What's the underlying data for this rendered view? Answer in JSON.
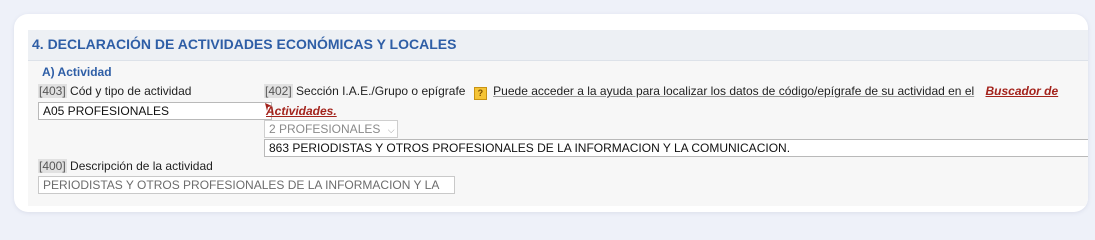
{
  "section": {
    "title": "4. DECLARACIÓN DE ACTIVIDADES ECONÓMICAS Y LOCALES"
  },
  "subsection": {
    "title": "A) Actividad"
  },
  "field_403": {
    "code": "[403]",
    "label": "Cód y tipo de actividad",
    "value": "A05 PROFESIONALES"
  },
  "field_402": {
    "code": "[402]",
    "label": "Sección I.A.E./Grupo o epígrafe",
    "help_icon": "help-icon",
    "help_text": "Puede acceder a la ayuda para localizar los datos de código/epígrafe de su actividad en el",
    "help_link_part1": "Buscador de",
    "help_link_part2": "Actividades.",
    "select_value": "2 PROFESIONALES",
    "epigrafe_value": "863 PERIODISTAS Y OTROS PROFESIONALES DE LA INFORMACION Y LA COMUNICACION."
  },
  "field_400": {
    "code": "[400]",
    "label": "Descripción de la actividad",
    "value": "PERIODISTAS Y OTROS PROFESIONALES DE LA INFORMACION Y LA"
  },
  "colors": {
    "heading": "#2e5ea6",
    "link": "#a3231c",
    "help_icon": "#f5c436"
  }
}
